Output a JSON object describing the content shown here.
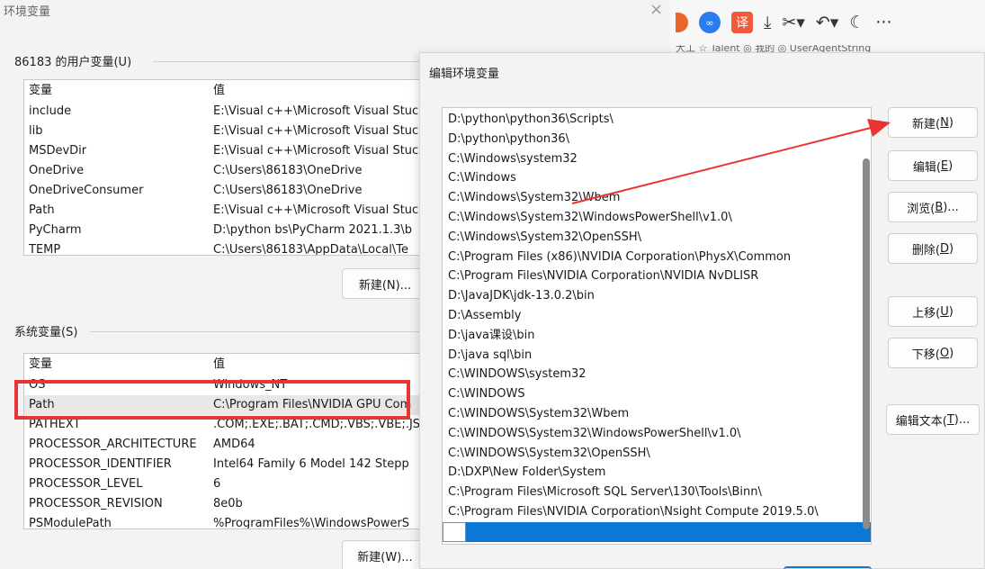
{
  "bg_dialog": {
    "title": "环境变量",
    "close": "×",
    "user_section_label": "86183 的用户变量(U)",
    "system_section_label": "系统变量(S)",
    "col_var": "变量",
    "col_value": "值",
    "user_vars": [
      {
        "name": "include",
        "value": "E:\\Visual c++\\Microsoft Visual Stuc"
      },
      {
        "name": "lib",
        "value": "E:\\Visual c++\\Microsoft Visual Stuc"
      },
      {
        "name": "MSDevDir",
        "value": "E:\\Visual c++\\Microsoft Visual Stuc"
      },
      {
        "name": "OneDrive",
        "value": "C:\\Users\\86183\\OneDrive"
      },
      {
        "name": "OneDriveConsumer",
        "value": "C:\\Users\\86183\\OneDrive"
      },
      {
        "name": "Path",
        "value": "E:\\Visual c++\\Microsoft Visual Stuc"
      },
      {
        "name": "PyCharm",
        "value": "D:\\python bs\\PyCharm 2021.1.3\\b"
      },
      {
        "name": "TEMP",
        "value": "C:\\Users\\86183\\AppData\\Local\\Te"
      }
    ],
    "system_vars": [
      {
        "name": "OS",
        "value": "Windows_NT"
      },
      {
        "name": "Path",
        "value": "C:\\Program Files\\NVIDIA GPU Com"
      },
      {
        "name": "PATHEXT",
        "value": ".COM;.EXE;.BAT;.CMD;.VBS;.VBE;.JS;"
      },
      {
        "name": "PROCESSOR_ARCHITECTURE",
        "value": "AMD64"
      },
      {
        "name": "PROCESSOR_IDENTIFIER",
        "value": "Intel64 Family 6 Model 142 Stepp"
      },
      {
        "name": "PROCESSOR_LEVEL",
        "value": "6"
      },
      {
        "name": "PROCESSOR_REVISION",
        "value": "8e0b"
      },
      {
        "name": "PSModulePath",
        "value": "%ProgramFiles%\\WindowsPowerS"
      }
    ],
    "user_new_button": "新建(N)...",
    "system_new_button": "新建(W)..."
  },
  "toolbar": {
    "blue_icon_text": "∞",
    "red_icon_text": "译",
    "download": "⤓",
    "cut": "✂▾",
    "undo": "↶▾",
    "moon": "☾",
    "more": "···",
    "bookmarks_text": "大工  ☆ Talent  ◎ 我的  ◎ UserAgentString"
  },
  "edit_dialog": {
    "title": "编辑环境变量",
    "paths": [
      "D:\\python\\python36\\Scripts\\",
      "D:\\python\\python36\\",
      "C:\\Windows\\system32",
      "C:\\Windows",
      "C:\\Windows\\System32\\Wbem",
      "C:\\Windows\\System32\\WindowsPowerShell\\v1.0\\",
      "C:\\Windows\\System32\\OpenSSH\\",
      "C:\\Program Files (x86)\\NVIDIA Corporation\\PhysX\\Common",
      "C:\\Program Files\\NVIDIA Corporation\\NVIDIA NvDLISR",
      "D:\\JavaJDK\\jdk-13.0.2\\bin",
      "D:\\Assembly",
      "D:\\java课设\\bin",
      "D:\\java sql\\bin",
      "C:\\WINDOWS\\system32",
      "C:\\WINDOWS",
      "C:\\WINDOWS\\System32\\Wbem",
      "C:\\WINDOWS\\System32\\WindowsPowerShell\\v1.0\\",
      "C:\\WINDOWS\\System32\\OpenSSH\\",
      "D:\\DXP\\New Folder\\System",
      "C:\\Program Files\\Microsoft SQL Server\\130\\Tools\\Binn\\",
      "C:\\Program Files\\NVIDIA Corporation\\Nsight Compute 2019.5.0\\"
    ],
    "btn_new": {
      "text": "新建(",
      "key": "N",
      "end": ")"
    },
    "btn_edit": {
      "text": "编辑(",
      "key": "E",
      "end": ")"
    },
    "btn_browse": {
      "text": "浏览(",
      "key": "B",
      "end": ")..."
    },
    "btn_delete": {
      "text": "删除(",
      "key": "D",
      "end": ")"
    },
    "btn_up": {
      "text": "上移(",
      "key": "U",
      "end": ")"
    },
    "btn_down": {
      "text": "下移(",
      "key": "O",
      "end": ")"
    },
    "btn_edit_text": {
      "text": "编辑文本(",
      "key": "T",
      "end": ")..."
    }
  },
  "colors": {
    "annotation_red": "#e83434",
    "selection_blue": "#0a78d4"
  }
}
